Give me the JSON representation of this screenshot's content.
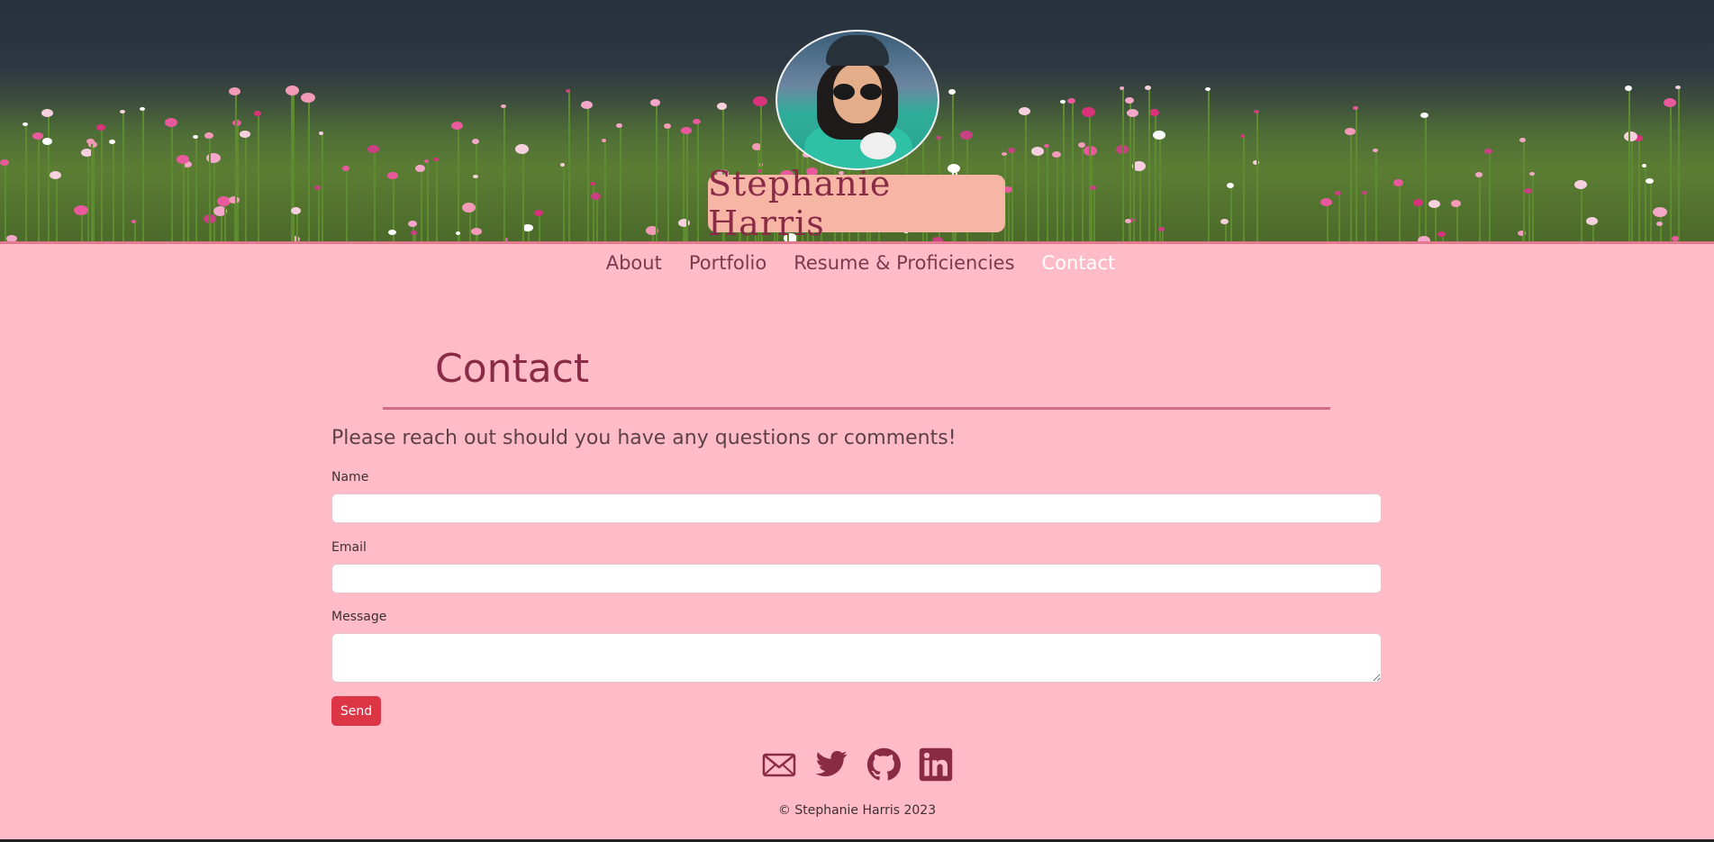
{
  "header": {
    "name": "Stephanie Harris",
    "avatar_alt": "Stephanie Harris"
  },
  "nav": {
    "items": [
      {
        "label": "About",
        "active": false
      },
      {
        "label": "Portfolio",
        "active": false
      },
      {
        "label": "Resume & Proficiencies",
        "active": false
      },
      {
        "label": "Contact",
        "active": true
      }
    ]
  },
  "main": {
    "title": "Contact",
    "intro": "Please reach out should you have any questions or comments!",
    "form": {
      "name_label": "Name",
      "name_value": "",
      "email_label": "Email",
      "email_value": "",
      "message_label": "Message",
      "message_value": "",
      "send_label": "Send"
    }
  },
  "footer": {
    "socials": [
      {
        "name": "email",
        "icon": "envelope-icon"
      },
      {
        "name": "twitter",
        "icon": "twitter-icon"
      },
      {
        "name": "github",
        "icon": "github-icon"
      },
      {
        "name": "linkedin",
        "icon": "linkedin-icon"
      }
    ],
    "copyright": "© Stephanie Harris 2023"
  },
  "colors": {
    "background": "#ffbbc8",
    "accent": "#8a2b46",
    "send_button": "#dc3545",
    "nav_active": "#ffffff",
    "name_box": "#f6b5a5"
  }
}
